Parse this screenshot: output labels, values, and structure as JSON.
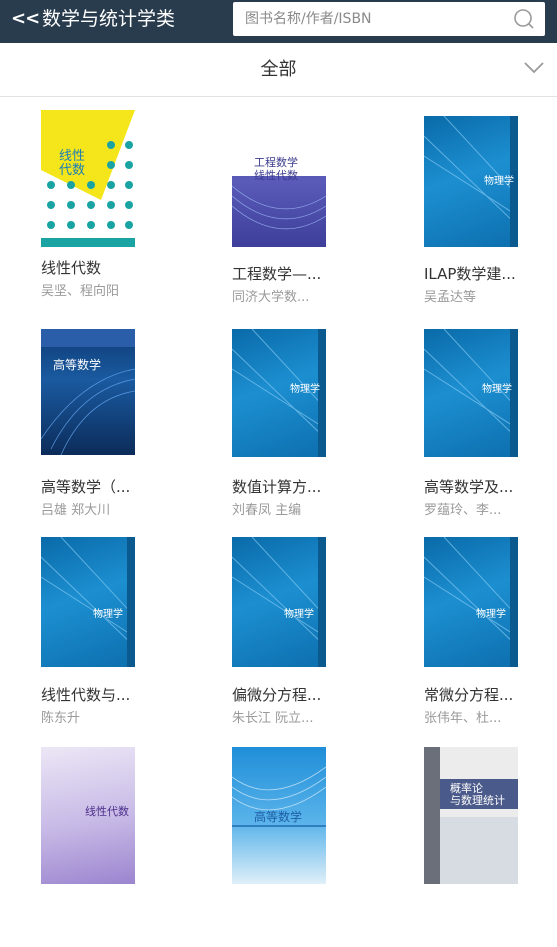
{
  "header": {
    "back_label": "<<",
    "title": "数学与统计学类",
    "search_placeholder": "图书名称/作者/ISBN"
  },
  "filter": {
    "label": "全部"
  },
  "books": [
    {
      "title": "线性代数",
      "author": "吴坚、程向阳",
      "cover_text": "线性\n代数"
    },
    {
      "title": "工程数学—...",
      "author": "同济大学数...",
      "cover_text": "工程数学\n线性代数"
    },
    {
      "title": "ILAP数学建...",
      "author": "吴孟达等",
      "cover_text": "物理学"
    },
    {
      "title": "高等数学（...",
      "author": "吕雄 郑大川",
      "cover_text": "高等数学"
    },
    {
      "title": "数值计算方...",
      "author": "刘春凤 主编",
      "cover_text": "物理学"
    },
    {
      "title": "高等数学及...",
      "author": "罗蕴玲、李...",
      "cover_text": "物理学"
    },
    {
      "title": "线性代数与...",
      "author": "陈东升",
      "cover_text": "物理学"
    },
    {
      "title": "偏微分方程...",
      "author": "朱长江 阮立...",
      "cover_text": "物理学"
    },
    {
      "title": "常微分方程...",
      "author": "张伟年、杜...",
      "cover_text": "物理学"
    },
    {
      "title": "",
      "author": "",
      "cover_text": "线性代数"
    },
    {
      "title": "",
      "author": "",
      "cover_text": "高等数学"
    },
    {
      "title": "",
      "author": "",
      "cover_text": "概率论\n与数理统计"
    }
  ],
  "colors": {
    "header_bg": "#293c4e",
    "accent_yellow": "#f5e61c",
    "teal": "#1aa3a3"
  }
}
